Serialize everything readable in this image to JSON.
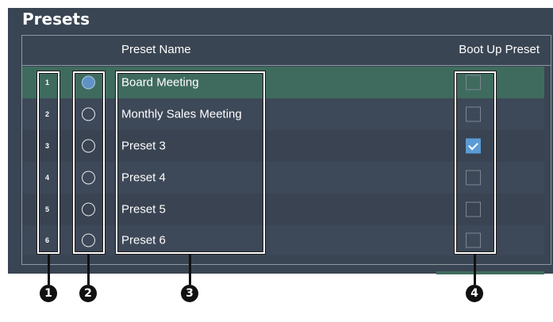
{
  "panel": {
    "title": "Presets"
  },
  "table": {
    "header": {
      "name": "Preset Name",
      "boot": "Boot Up Preset"
    },
    "rows": [
      {
        "number": "1",
        "name": "Board Meeting",
        "selected": true,
        "boot_up": false
      },
      {
        "number": "2",
        "name": "Monthly Sales Meeting",
        "selected": false,
        "boot_up": false
      },
      {
        "number": "3",
        "name": "Preset 3",
        "selected": false,
        "boot_up": true
      },
      {
        "number": "4",
        "name": "Preset 4",
        "selected": false,
        "boot_up": false
      },
      {
        "number": "5",
        "name": "Preset 5",
        "selected": false,
        "boot_up": false
      },
      {
        "number": "6",
        "name": "Preset 6",
        "selected": false,
        "boot_up": false
      }
    ]
  },
  "callouts": [
    "1",
    "2",
    "3",
    "4"
  ],
  "colors": {
    "panel_bg": "#3a4553",
    "selected_row": "#3f6b5e",
    "radio_selected": "#5f93c5",
    "checkbox_checked": "#5b9bd5"
  }
}
